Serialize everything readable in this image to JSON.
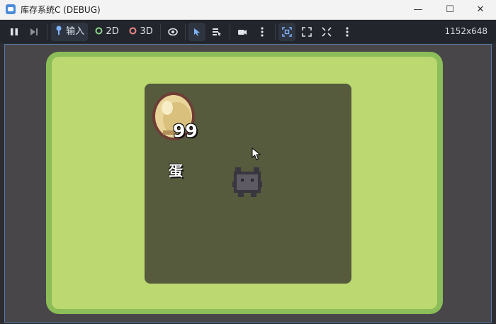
{
  "window": {
    "title": "库存系统C (DEBUG)",
    "controls": {
      "minimize": "—",
      "maximize": "☐",
      "close": "✕"
    }
  },
  "toolbar": {
    "input_label": "输入",
    "label_2d": "2D",
    "label_3d": "3D",
    "resolution": "1152x648"
  },
  "game": {
    "item_count": "99",
    "item_name": "蛋"
  },
  "colors": {
    "grass": "#bcd870",
    "grass_border": "#8bbd58",
    "panel": "#555b3c",
    "accent": "#5a79a8"
  }
}
